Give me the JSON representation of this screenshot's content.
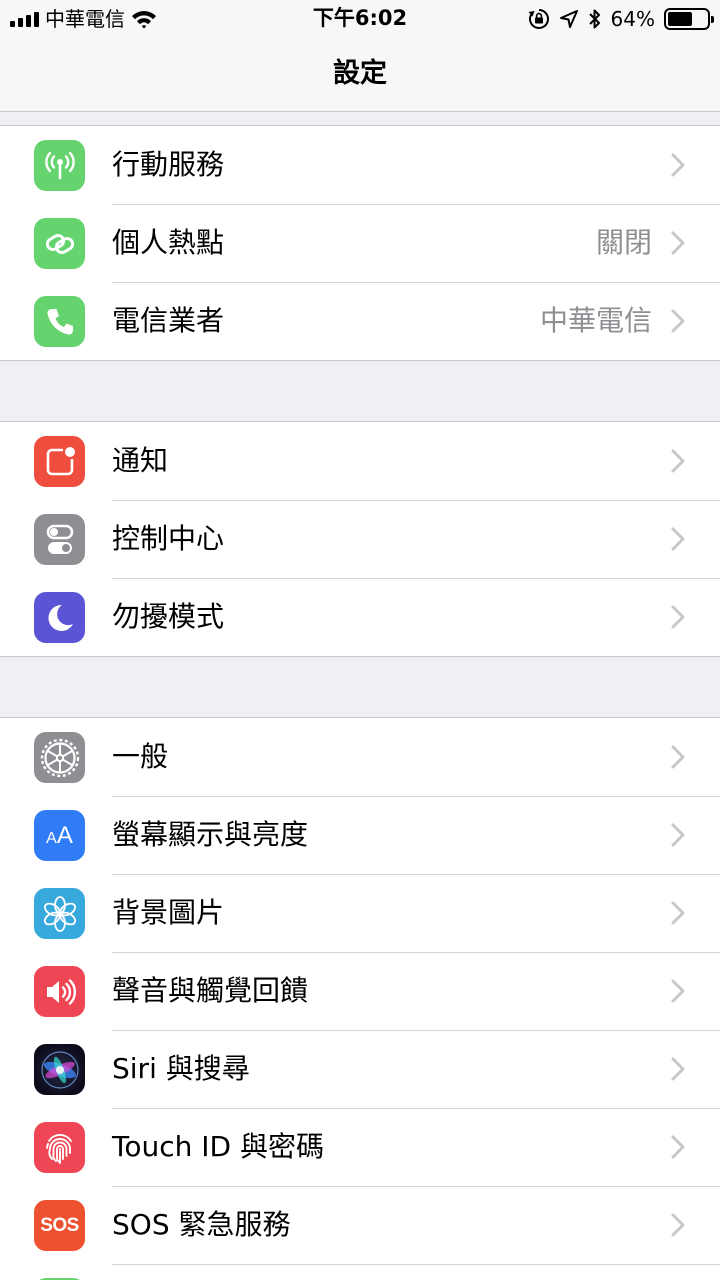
{
  "status_bar": {
    "carrier": "中華電信",
    "time": "下午6:02",
    "battery_percent_label": "64%",
    "battery_level": 0.64,
    "icons": [
      "signal-icon",
      "wifi-icon",
      "rotation-lock-icon",
      "location-icon",
      "bluetooth-icon",
      "battery-icon"
    ]
  },
  "nav": {
    "title": "設定"
  },
  "groups": [
    {
      "rows": [
        {
          "label": "行動服務",
          "value": "",
          "icon": "cellular-icon",
          "color": "#65d36e"
        },
        {
          "label": "個人熱點",
          "value": "關閉",
          "icon": "hotspot-icon",
          "color": "#65d36e"
        },
        {
          "label": "電信業者",
          "value": "中華電信",
          "icon": "phone-icon",
          "color": "#65d36e"
        }
      ]
    },
    {
      "rows": [
        {
          "label": "通知",
          "value": "",
          "icon": "notifications-icon",
          "color": "#ef4e3f"
        },
        {
          "label": "控制中心",
          "value": "",
          "icon": "control-center-icon",
          "color": "#8e8e93"
        },
        {
          "label": "勿擾模式",
          "value": "",
          "icon": "moon-icon",
          "color": "#5b55d6"
        }
      ]
    },
    {
      "rows": [
        {
          "label": "一般",
          "value": "",
          "icon": "gear-icon",
          "color": "#8e8e93"
        },
        {
          "label": "螢幕顯示與亮度",
          "value": "",
          "icon": "display-brightness-icon",
          "color": "#2f7cf6"
        },
        {
          "label": "背景圖片",
          "value": "",
          "icon": "wallpaper-icon",
          "color": "#38a9dc"
        },
        {
          "label": "聲音與觸覺回饋",
          "value": "",
          "icon": "speaker-icon",
          "color": "#ef4656"
        },
        {
          "label": "Siri 與搜尋",
          "value": "",
          "icon": "siri-icon",
          "color": "#1c1c3a"
        },
        {
          "label": "Touch ID 與密碼",
          "value": "",
          "icon": "fingerprint-icon",
          "color": "#ef4656"
        },
        {
          "label": "SOS 緊急服務",
          "value": "",
          "icon": "sos-icon",
          "icon_text": "SOS",
          "color": "#ee5130"
        },
        {
          "label": "",
          "value": "",
          "icon": "battery-settings-icon",
          "color": "#65d36e"
        }
      ]
    }
  ]
}
